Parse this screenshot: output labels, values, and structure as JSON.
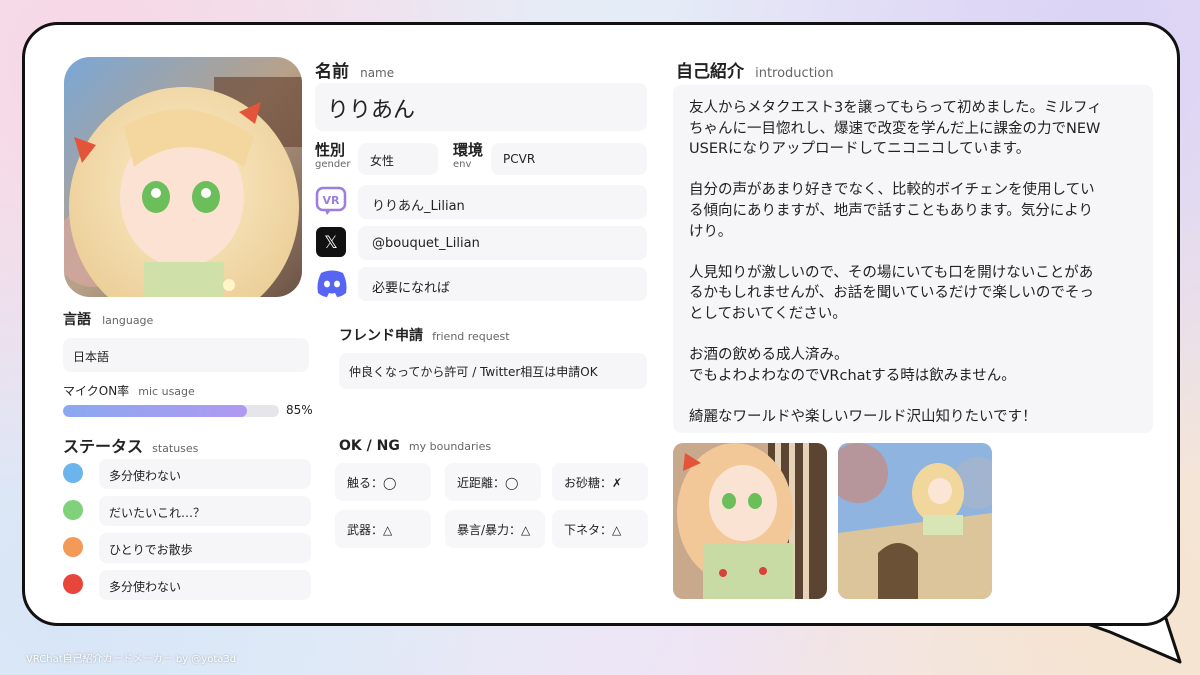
{
  "name": {
    "label": "名前",
    "label_en": "name",
    "value": "りりあん"
  },
  "gender": {
    "label": "性別",
    "label_en": "gender",
    "value": "女性"
  },
  "env": {
    "label": "環境",
    "label_en": "env",
    "value": "PCVR"
  },
  "accounts": {
    "vrchat_icon": "VR",
    "vrchat": "りりあん_Lilian",
    "x_icon": "𝕏",
    "x": "@bouquet_Lilian",
    "discord": "必要になれば"
  },
  "language": {
    "label": "言語",
    "label_en": "language",
    "value": "日本語"
  },
  "mic": {
    "label": "マイクON率",
    "label_en": "mic usage",
    "percent_text": "85%",
    "percent": 85,
    "bar_color": "#a99af0"
  },
  "statuses": {
    "label": "ステータス",
    "label_en": "statuses",
    "items": [
      {
        "color": "#6cb4ec",
        "text": "多分使わない"
      },
      {
        "color": "#7fd27a",
        "text": "だいたいこれ…？"
      },
      {
        "color": "#f39a58",
        "text": "ひとりでお散歩"
      },
      {
        "color": "#e8453c",
        "text": "多分使わない"
      }
    ]
  },
  "friend_request": {
    "label": "フレンド申請",
    "label_en": "friend request",
    "value": "仲良くなってから許可 / Twitter相互は申請OK"
  },
  "boundaries": {
    "label": "OK / NG",
    "label_en": "my boundaries",
    "items": [
      "触る：◯",
      "近距離：◯",
      "お砂糖：✗",
      "武器：△",
      "暴言/暴力：△",
      "下ネタ：△"
    ]
  },
  "introduction": {
    "label": "自己紹介",
    "label_en": "introduction",
    "lines": [
      "友人からメタクエスト3を譲ってもらって初めました。ミルフィ",
      "ちゃんに一目惚れし、爆速で改変を学んだ上に課金の力でNEW",
      "USERになりアップロードしてニコニコしています。",
      "",
      "自分の声があまり好きでなく、比較的ボイチェンを使用してい",
      "る傾向にありますが、地声で話すこともあります。気分により",
      "けり。",
      "",
      "人見知りが激しいので、その場にいても口を開けないことがあ",
      "るかもしれませんが、お話を聞いているだけで楽しいのでそっ",
      "としておいてください。",
      "",
      "お酒の飲める成人済み。",
      "でもよわよわなのでVRchatする時は飲みません。",
      "",
      "綺麗なワールドや楽しいワールド沢山知りたいです！"
    ]
  },
  "footer": {
    "credit": "VRChat自己紹介カードメーカー by @yota3d"
  },
  "colors": {
    "vrchat_icon": "#9b7ee0",
    "discord_icon": "#5865f2",
    "x_icon_bg": "#111111"
  }
}
